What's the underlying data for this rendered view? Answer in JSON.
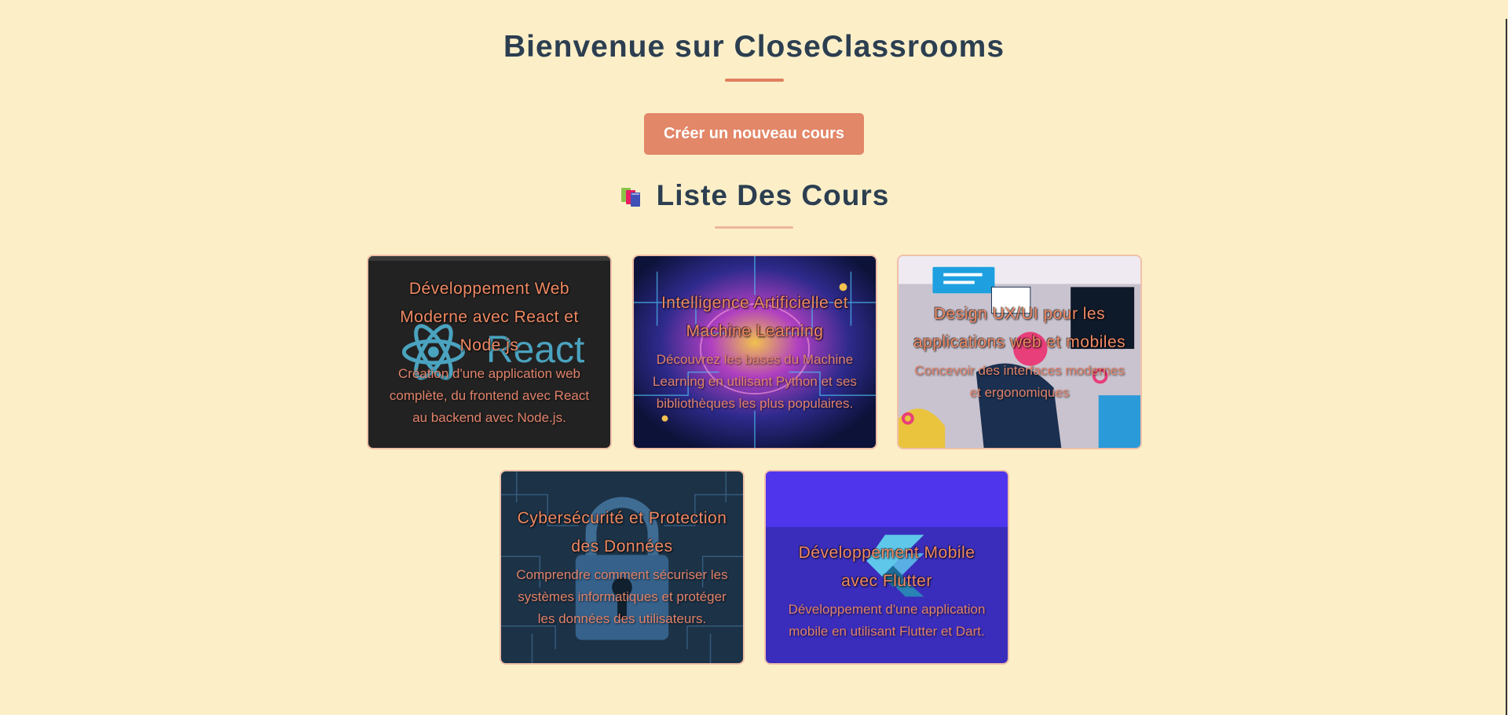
{
  "header": {
    "title": "Bienvenue sur CloseClassrooms",
    "create_button_label": "Créer un nouveau cours"
  },
  "section": {
    "icon": "books-icon",
    "title": "Liste Des Cours"
  },
  "courses": [
    {
      "title": "Développement Web Moderne avec React et Node.js",
      "description": "Création d'une application web complète, du frontend avec React au backend avec Node.js.",
      "image": "react-logo",
      "logo_text": "React"
    },
    {
      "title": "Intelligence Artificielle et Machine Learning",
      "description": "Découvrez les bases du Machine Learning en utilisant Python et ses bibliothèques les plus populaires.",
      "image": "ai-brain-circuit"
    },
    {
      "title": "Design UX/UI pour les applications web et mobiles",
      "description": "Concevoir des interfaces modernes et ergonomiques",
      "image": "ux-design-illustration"
    },
    {
      "title": "Cybersécurité et Protection des Données",
      "description": "Comprendre comment sécuriser les systèmes informatiques et protéger les données des utilisateurs.",
      "image": "padlock-circuit"
    },
    {
      "title": "Développement Mobile avec Flutter",
      "description": "Développement d'une application mobile en utilisant Flutter et Dart.",
      "image": "flutter-logo"
    }
  ],
  "colors": {
    "background": "#fcefc8",
    "heading": "#2c3e50",
    "accent": "#e28768",
    "card_text": "#f08a64"
  }
}
